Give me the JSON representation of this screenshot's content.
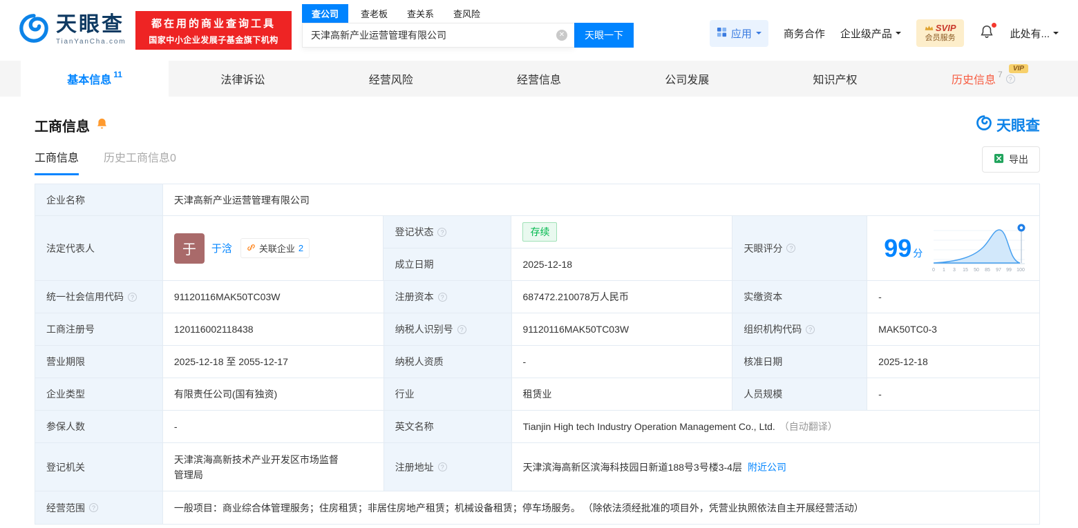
{
  "icons": {
    "help": "?",
    "clear": "✕"
  },
  "brand": {
    "name": "天眼查",
    "domain": "TianYanCha.com",
    "blue": "#0084ff",
    "red": "#ee2424"
  },
  "header": {
    "slogan_line1": "都在用的商业查询工具",
    "slogan_line2": "国家中小企业发展子基金旗下机构",
    "search_tabs": [
      {
        "label": "查公司"
      },
      {
        "label": "查老板"
      },
      {
        "label": "查关系"
      },
      {
        "label": "查风险"
      }
    ],
    "search_value": "天津高新产业运营管理有限公司",
    "search_button": "天眼一下",
    "apps_label": "应用",
    "biz_label": "商务合作",
    "enterprise_label": "企业级产品",
    "svip_line1": "SVIP",
    "svip_line2": "会员服务",
    "user_label": "此处有..."
  },
  "nav": {
    "tabs": [
      {
        "label": "基本信息",
        "count": "11"
      },
      {
        "label": "法律诉讼"
      },
      {
        "label": "经营风险"
      },
      {
        "label": "经营信息"
      },
      {
        "label": "公司发展"
      },
      {
        "label": "知识产权"
      },
      {
        "label": "历史信息",
        "count": "7",
        "vip": "VIP"
      }
    ]
  },
  "section": {
    "title": "工商信息",
    "watermark": "天眼查",
    "subtab_active": "工商信息",
    "subtab_history": "历史工商信息0",
    "export_label": "导出"
  },
  "fields": {
    "company_name": {
      "label": "企业名称",
      "value": "天津高新产业运营管理有限公司"
    },
    "legal_rep": {
      "label": "法定代表人",
      "avatar_char": "于",
      "name": "于浛",
      "related_label": "关联企业",
      "related_count": "2"
    },
    "reg_status": {
      "label": "登记状态",
      "value": "存续"
    },
    "establish_date": {
      "label": "成立日期",
      "value": "2025-12-18"
    },
    "score": {
      "label": "天眼评分",
      "value": "99",
      "unit": "分",
      "axis": [
        "0",
        "1",
        "3",
        "15",
        "50",
        "85",
        "97",
        "99",
        "100"
      ]
    },
    "credit_code": {
      "label": "统一社会信用代码",
      "value": "91120116MAK50TC03W"
    },
    "reg_capital": {
      "label": "注册资本",
      "value": "687472.210078万人民币"
    },
    "paid_capital": {
      "label": "实缴资本",
      "value": "-"
    },
    "reg_number": {
      "label": "工商注册号",
      "value": "120116002118438"
    },
    "taxpayer_id": {
      "label": "纳税人识别号",
      "value": "91120116MAK50TC03W"
    },
    "org_code": {
      "label": "组织机构代码",
      "value": "MAK50TC0-3"
    },
    "business_term": {
      "label": "营业期限",
      "value": "2025-12-18 至 2055-12-17"
    },
    "taxpayer_qual": {
      "label": "纳税人资质",
      "value": "-"
    },
    "approval_date": {
      "label": "核准日期",
      "value": "2025-12-18"
    },
    "company_type": {
      "label": "企业类型",
      "value": "有限责任公司(国有独资)"
    },
    "industry": {
      "label": "行业",
      "value": "租赁业"
    },
    "staff_size": {
      "label": "人员规模",
      "value": "-"
    },
    "insured_count": {
      "label": "参保人数",
      "value": "-"
    },
    "english_name": {
      "label": "英文名称",
      "value": "Tianjin High tech Industry Operation Management Co., Ltd.",
      "note": "（自动翻译）"
    },
    "reg_authority": {
      "label": "登记机关",
      "value": "天津滨海高新技术产业开发区市场监督管理局"
    },
    "reg_address": {
      "label": "注册地址",
      "value": "天津滨海高新区滨海科技园日新道188号3号楼3-4层",
      "link": "附近公司"
    },
    "business_scope": {
      "label": "经营范围",
      "value": "一般项目：商业综合体管理服务；住房租赁；非居住房地产租赁；机械设备租赁；停车场服务。 （除依法须经批准的项目外，凭营业执照依法自主开展经营活动）"
    }
  }
}
